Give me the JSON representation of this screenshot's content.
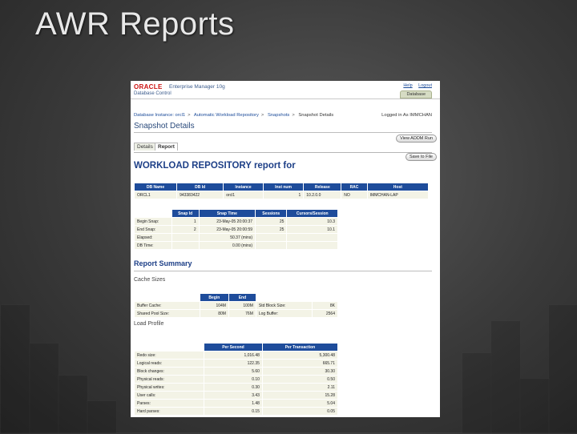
{
  "slide": {
    "title": "AWR Reports"
  },
  "app": {
    "logo": "ORACLE",
    "product": "Enterprise Manager 10g",
    "subtitle": "Database Control",
    "links": [
      "Help",
      "Logout"
    ],
    "db_tab": "Database"
  },
  "breadcrumb": {
    "items": [
      "Database Instance: orcl1",
      "Automatic Workload Repository",
      "Snapshots"
    ],
    "current": "Snapshot Details"
  },
  "login": "Logged in As IMMCHAN",
  "page_title": "Snapshot Details",
  "tabs": [
    "Details",
    "Report"
  ],
  "buttons": {
    "view_addm": "View ADDM Run",
    "save_file": "Save to File"
  },
  "report": {
    "heading": "WORKLOAD REPOSITORY report for",
    "db_table": {
      "headers": [
        "DB Name",
        "DB Id",
        "Instance",
        "Inst num",
        "Release",
        "RAC",
        "Host"
      ],
      "row": [
        "ORCL1",
        "943383422",
        "orcl1",
        "1",
        "10.2.0.0",
        "NO",
        "IMMCHAN-LAP"
      ]
    },
    "snap_table": {
      "headers": [
        "",
        "Snap Id",
        "Snap Time",
        "Sessions",
        "Cursors/Session"
      ],
      "rows": [
        [
          "Begin Snap:",
          "1",
          "23-May-05 20:00:37",
          "25",
          "10.3"
        ],
        [
          "End Snap:",
          "2",
          "23-May-05 20:00:59",
          "25",
          "10.1"
        ],
        [
          "Elapsed:",
          "",
          "50.37 (mins)",
          "",
          ""
        ],
        [
          "DB Time:",
          "",
          "0.00 (mins)",
          "",
          ""
        ]
      ]
    },
    "summary_heading": "Report Summary",
    "cache": {
      "label": "Cache Sizes",
      "headers": [
        "",
        "Begin",
        "End",
        "",
        ""
      ],
      "rows": [
        [
          "Buffer Cache:",
          "104M",
          "100M",
          "Std Block Size:",
          "8K"
        ],
        [
          "Shared Pool Size:",
          "80M",
          "76M",
          "Log Buffer:",
          "2564"
        ]
      ]
    },
    "load": {
      "label": "Load Profile",
      "headers": [
        "",
        "Per Second",
        "Per Transaction"
      ],
      "rows": [
        [
          "Redo size:",
          "1,016.48",
          "5,300.48"
        ],
        [
          "Logical reads:",
          "122.35",
          "665.71"
        ],
        [
          "Block changes:",
          "5.60",
          "30.30"
        ],
        [
          "Physical reads:",
          "0.10",
          "0.50"
        ],
        [
          "Physical writes:",
          "0.30",
          "2.11"
        ],
        [
          "User calls:",
          "3.43",
          "15.28"
        ],
        [
          "Parses:",
          "1.48",
          "5.04"
        ],
        [
          "Hard parses:",
          "0.15",
          "0.05"
        ]
      ]
    }
  }
}
